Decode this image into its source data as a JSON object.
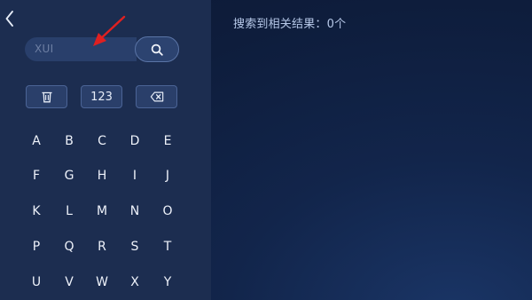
{
  "search": {
    "value": "XUI"
  },
  "toolbar": {
    "number_label": "123"
  },
  "results": {
    "summary": "搜索到相关结果：0个"
  },
  "keyboard": {
    "rows": [
      [
        "A",
        "B",
        "C",
        "D",
        "E"
      ],
      [
        "F",
        "G",
        "H",
        "I",
        "J"
      ],
      [
        "K",
        "L",
        "M",
        "N",
        "O"
      ],
      [
        "P",
        "Q",
        "R",
        "S",
        "T"
      ],
      [
        "U",
        "V",
        "W",
        "X",
        "Y"
      ]
    ]
  },
  "icons": {
    "back": "chevron-left-icon",
    "search": "search-icon",
    "clear": "trash-icon",
    "delete": "backspace-icon",
    "annotation": "red-arrow"
  },
  "colors": {
    "panel": "#1c2d50",
    "background": "#0e1d3c",
    "arrow": "#e02020"
  }
}
